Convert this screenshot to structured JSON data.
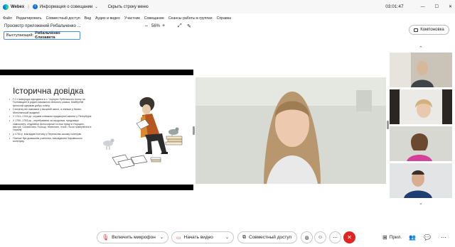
{
  "titlebar": {
    "app_name": "Webex",
    "meeting_info": "Информация о совещании",
    "hide_menu": "Скрыть строку меню",
    "timer": "03:01:47"
  },
  "menu": {
    "items": [
      "Файл",
      "Редактировать",
      "Совместный доступ",
      "Вид",
      "Аудио и видео",
      "Участник",
      "Совещание",
      "Сеансы работы в группах",
      "Справка"
    ]
  },
  "sharebar": {
    "title": "Просмотр приложений Рибальченко ...",
    "zoom": "56%",
    "zoom_minus": "–",
    "zoom_plus": "+"
  },
  "layout_button": {
    "label": "Компоновка"
  },
  "presenter": {
    "prefix": "Выступающий:",
    "name": "Рибальченко Єлизавета"
  },
  "slide": {
    "title": "Історична довідка",
    "bullets": [
      "Г.С.Сковорода народився в с. Чорнухи Лубенського полку на Полтавщині в родині заможного вільного козака. Майбутній філософ одержав добру освіту.",
      "Спочатку він навчався у місцевій школі, а пізніше у Києво-Могилянській академії.",
      "У 1741–1744 рр. служив співаком придворної капели у Петербурзі.",
      "У 1750–1753 рр., перебуваючи за кордоном, продовжує самоосвіту, студіюючи філософські та інші праці в Угорщині, Австрії, Словаччині, Польщі, Німеччині, Італії. Після повернення в Україну",
      "у 1753 р. викладав поетику у Переяслав-ському колегіумі.",
      "Пізніше був домашнім учителем, викладачем Харківського колегіуму."
    ]
  },
  "controls": {
    "mic": "Включить микрофон",
    "video": "Начать видео",
    "share": "Совместный доступ",
    "apps": "Прил."
  },
  "colors": {
    "accent": "#1a6fd9",
    "end_call": "#e02424",
    "mic_muted": "#d63030"
  }
}
